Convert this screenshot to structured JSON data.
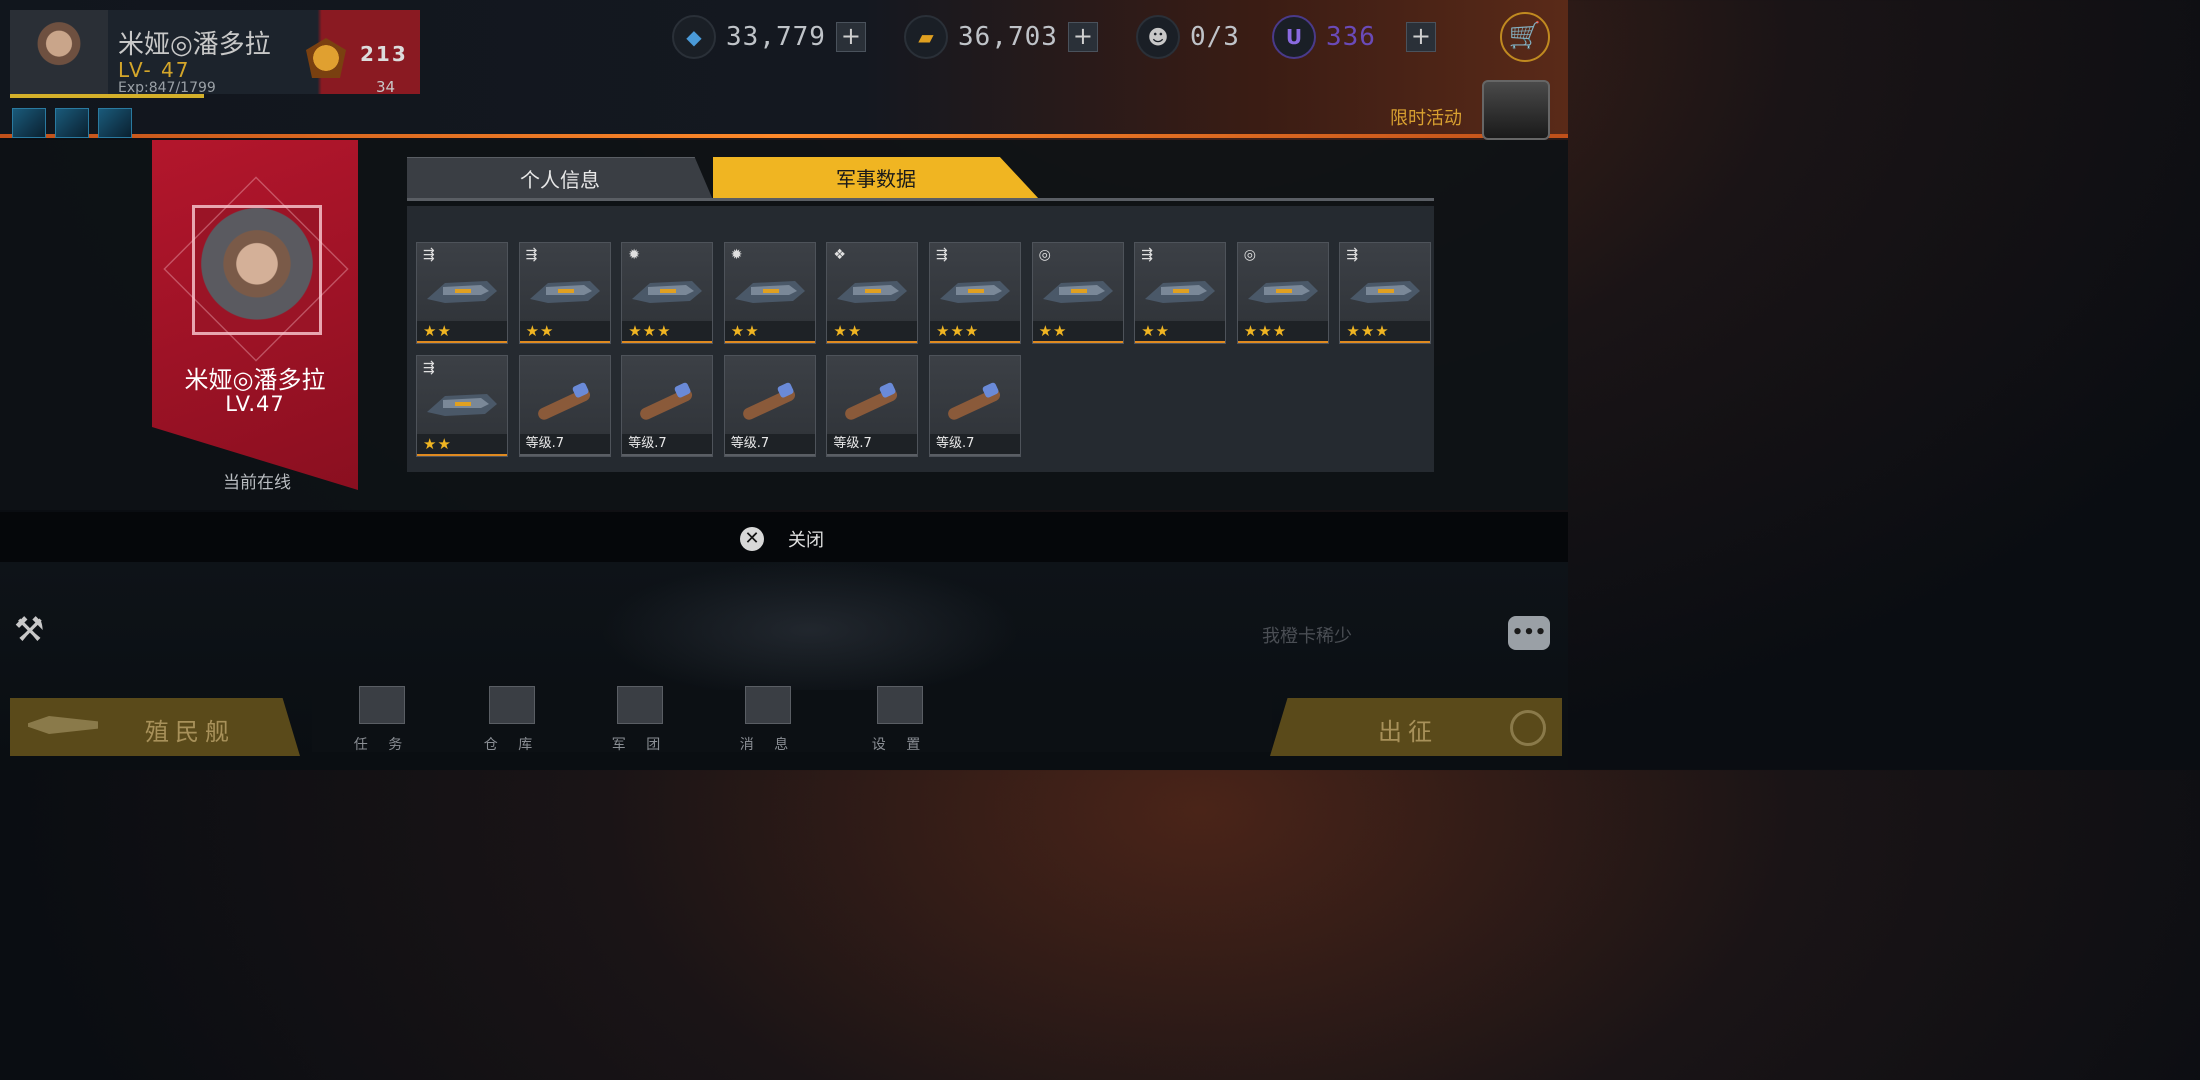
{
  "player": {
    "name": "米娅◎潘多拉",
    "level": "LV- 47",
    "exp": "Exp:847/1799",
    "rank_digits": "213",
    "rank_number": "34"
  },
  "resources": {
    "crystal": "33,779",
    "gold": "36,703",
    "fleet": "0/3",
    "premium": "336",
    "premium_icon": "U"
  },
  "event": {
    "label": "限时活动"
  },
  "profile": {
    "name": "米娅◎潘多拉",
    "level": "LV.47",
    "status": "当前在线"
  },
  "tabs": {
    "personal": "个人信息",
    "military": "军事数据"
  },
  "items": [
    {
      "foot": "★★",
      "kind": "stars",
      "type_icon": "missile-icon"
    },
    {
      "foot": "★★",
      "kind": "stars",
      "type_icon": "missile-icon"
    },
    {
      "foot": "★★★",
      "kind": "stars",
      "type_icon": "burst-icon"
    },
    {
      "foot": "★★",
      "kind": "stars",
      "type_icon": "burst-icon"
    },
    {
      "foot": "★★",
      "kind": "stars",
      "type_icon": "heart-shield-icon"
    },
    {
      "foot": "★★★",
      "kind": "stars",
      "type_icon": "missile-icon"
    },
    {
      "foot": "★★",
      "kind": "stars",
      "type_icon": "target-icon"
    },
    {
      "foot": "★★",
      "kind": "stars",
      "type_icon": "missile-icon"
    },
    {
      "foot": "★★★",
      "kind": "stars",
      "type_icon": "target-icon"
    },
    {
      "foot": "★★★",
      "kind": "stars",
      "type_icon": "missile-icon"
    },
    {
      "foot": "★★",
      "kind": "stars",
      "type_icon": "missile-icon"
    },
    {
      "foot": "等级.7",
      "kind": "level",
      "type_icon": ""
    },
    {
      "foot": "等级.7",
      "kind": "level",
      "type_icon": ""
    },
    {
      "foot": "等级.7",
      "kind": "level",
      "type_icon": ""
    },
    {
      "foot": "等级.7",
      "kind": "level",
      "type_icon": ""
    },
    {
      "foot": "等级.7",
      "kind": "level",
      "type_icon": ""
    }
  ],
  "close": {
    "label": "关闭"
  },
  "chat": {
    "placeholder": "我橙卡稀少"
  },
  "bottom": {
    "colony": "殖民舰",
    "deploy": "出征",
    "nav": [
      "任 务",
      "仓 库",
      "军 团",
      "消 息",
      "设 置"
    ]
  },
  "colors": {
    "accent": "#f0b522",
    "profile_red": "#b3162c",
    "star": "#f0b522"
  }
}
